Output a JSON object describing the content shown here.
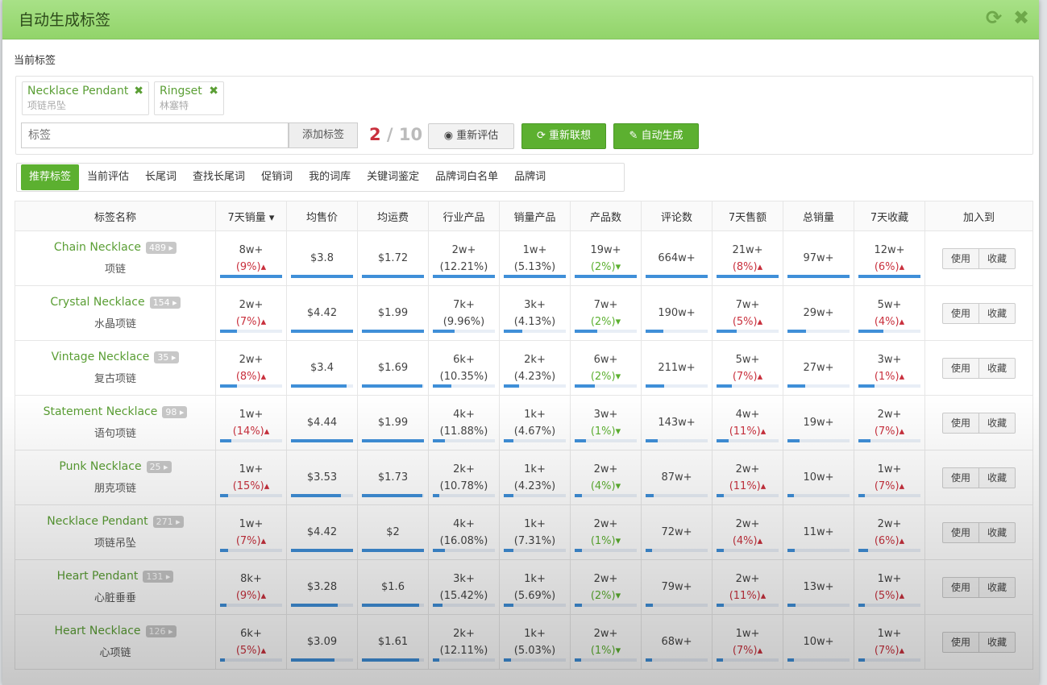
{
  "modal": {
    "title": "自动生成标签",
    "icons": [
      "refresh-icon",
      "close-icon"
    ]
  },
  "current_label": "当前标签",
  "chips": [
    {
      "en": "Necklace Pendant",
      "cn": "项链吊坠"
    },
    {
      "en": "Ringset",
      "cn": "林塞特"
    }
  ],
  "tag_input": {
    "placeholder": "标签"
  },
  "add_button": "添加标签",
  "count": {
    "current": "2",
    "sep": " / ",
    "max": "10"
  },
  "buttons": {
    "reevaluate": "重新评估",
    "reassociate": "重新联想",
    "autogen": "自动生成"
  },
  "tabs": [
    "推荐标签",
    "当前评估",
    "长尾词",
    "查找长尾词",
    "促销词",
    "我的词库",
    "关键词鉴定",
    "品牌词白名单",
    "品牌词"
  ],
  "table": {
    "headers": [
      "标签名称",
      "7天销量 ▾",
      "均售价",
      "均运费",
      "行业产品",
      "销量产品",
      "产品数",
      "评论数",
      "7天售额",
      "总销量",
      "7天收藏",
      "加入到"
    ],
    "action_use": "使用",
    "action_fav": "收藏",
    "rows": [
      {
        "en": "Chain Necklace",
        "count": "489",
        "cn": "项链",
        "sales7": "8w+",
        "sales7_pct": "(9%)▴",
        "price": "$3.8",
        "ship": "$1.72",
        "industry": "2w+",
        "industry_pct": "(12.21%)",
        "soldprod": "1w+",
        "soldprod_pct": "(5.13%)",
        "products": "19w+",
        "products_pct": "(2%)▾",
        "reviews": "664w+",
        "rev7": "21w+",
        "rev7_pct": "(8%)▴",
        "total": "97w+",
        "fav7": "12w+",
        "fav7_pct": "(6%)▴",
        "bars": [
          1.0,
          1.0,
          1.0,
          1.0,
          1.0,
          1.0,
          1.0,
          1.0,
          1.0,
          1.0
        ]
      },
      {
        "en": "Crystal Necklace",
        "count": "154",
        "cn": "水晶项链",
        "sales7": "2w+",
        "sales7_pct": "(7%)▴",
        "price": "$4.42",
        "ship": "$1.99",
        "industry": "7k+",
        "industry_pct": "(9.96%)",
        "soldprod": "3k+",
        "soldprod_pct": "(4.13%)",
        "products": "7w+",
        "products_pct": "(2%)▾",
        "reviews": "190w+",
        "rev7": "7w+",
        "rev7_pct": "(5%)▴",
        "total": "29w+",
        "fav7": "5w+",
        "fav7_pct": "(4%)▴",
        "bars": [
          0.27,
          1.0,
          1.0,
          0.35,
          0.3,
          0.36,
          0.28,
          0.33,
          0.3,
          0.4
        ]
      },
      {
        "en": "Vintage Necklace",
        "count": "35",
        "cn": "复古项链",
        "sales7": "2w+",
        "sales7_pct": "(8%)▴",
        "price": "$3.4",
        "ship": "$1.69",
        "industry": "6k+",
        "industry_pct": "(10.35%)",
        "soldprod": "2k+",
        "soldprod_pct": "(4.23%)",
        "products": "6w+",
        "products_pct": "(2%)▾",
        "reviews": "211w+",
        "rev7": "5w+",
        "rev7_pct": "(7%)▴",
        "total": "27w+",
        "fav7": "3w+",
        "fav7_pct": "(1%)▴",
        "bars": [
          0.27,
          0.9,
          0.98,
          0.3,
          0.25,
          0.32,
          0.3,
          0.25,
          0.28,
          0.26
        ]
      },
      {
        "en": "Statement Necklace",
        "count": "98",
        "cn": "语句项链",
        "sales7": "1w+",
        "sales7_pct": "(14%)▴",
        "price": "$4.44",
        "ship": "$1.99",
        "industry": "4k+",
        "industry_pct": "(11.88%)",
        "soldprod": "1k+",
        "soldprod_pct": "(4.67%)",
        "products": "3w+",
        "products_pct": "(1%)▾",
        "reviews": "143w+",
        "rev7": "4w+",
        "rev7_pct": "(11%)▴",
        "total": "19w+",
        "fav7": "2w+",
        "fav7_pct": "(7%)▴",
        "bars": [
          0.18,
          1.0,
          1.0,
          0.2,
          0.15,
          0.18,
          0.2,
          0.2,
          0.2,
          0.2
        ]
      },
      {
        "en": "Punk Necklace",
        "count": "25",
        "cn": "朋克项链",
        "sales7": "1w+",
        "sales7_pct": "(15%)▴",
        "price": "$3.53",
        "ship": "$1.73",
        "industry": "2k+",
        "industry_pct": "(10.78%)",
        "soldprod": "1k+",
        "soldprod_pct": "(4.23%)",
        "products": "2w+",
        "products_pct": "(4%)▾",
        "reviews": "87w+",
        "rev7": "2w+",
        "rev7_pct": "(11%)▴",
        "total": "10w+",
        "fav7": "1w+",
        "fav7_pct": "(7%)▴",
        "bars": [
          0.13,
          0.8,
          0.98,
          0.1,
          0.15,
          0.12,
          0.13,
          0.12,
          0.1,
          0.1
        ]
      },
      {
        "en": "Necklace Pendant",
        "count": "271",
        "cn": "项链吊坠",
        "sales7": "1w+",
        "sales7_pct": "(7%)▴",
        "price": "$4.42",
        "ship": "$2",
        "industry": "4k+",
        "industry_pct": "(16.08%)",
        "soldprod": "1k+",
        "soldprod_pct": "(7.31%)",
        "products": "2w+",
        "products_pct": "(1%)▾",
        "reviews": "72w+",
        "rev7": "2w+",
        "rev7_pct": "(4%)▴",
        "total": "11w+",
        "fav7": "2w+",
        "fav7_pct": "(6%)▴",
        "bars": [
          0.13,
          1.0,
          1.0,
          0.2,
          0.15,
          0.12,
          0.1,
          0.12,
          0.12,
          0.15
        ]
      },
      {
        "en": "Heart Pendant",
        "count": "131",
        "cn": "心脏垂垂",
        "sales7": "8k+",
        "sales7_pct": "(9%)▴",
        "price": "$3.28",
        "ship": "$1.6",
        "industry": "3k+",
        "industry_pct": "(15.42%)",
        "soldprod": "1k+",
        "soldprod_pct": "(5.69%)",
        "products": "2w+",
        "products_pct": "(2%)▾",
        "reviews": "79w+",
        "rev7": "2w+",
        "rev7_pct": "(11%)▴",
        "total": "13w+",
        "fav7": "1w+",
        "fav7_pct": "(5%)▴",
        "bars": [
          0.1,
          0.75,
          0.92,
          0.15,
          0.15,
          0.12,
          0.12,
          0.12,
          0.13,
          0.1
        ]
      },
      {
        "en": "Heart Necklace",
        "count": "126",
        "cn": "心项链",
        "sales7": "6k+",
        "sales7_pct": "(5%)▴",
        "price": "$3.09",
        "ship": "$1.61",
        "industry": "2k+",
        "industry_pct": "(12.11%)",
        "soldprod": "1k+",
        "soldprod_pct": "(5.03%)",
        "products": "2w+",
        "products_pct": "(1%)▾",
        "reviews": "68w+",
        "rev7": "1w+",
        "rev7_pct": "(7%)▴",
        "total": "10w+",
        "fav7": "1w+",
        "fav7_pct": "(7%)▴",
        "bars": [
          0.08,
          0.7,
          0.92,
          0.1,
          0.12,
          0.1,
          0.1,
          0.1,
          0.1,
          0.1
        ]
      }
    ]
  }
}
